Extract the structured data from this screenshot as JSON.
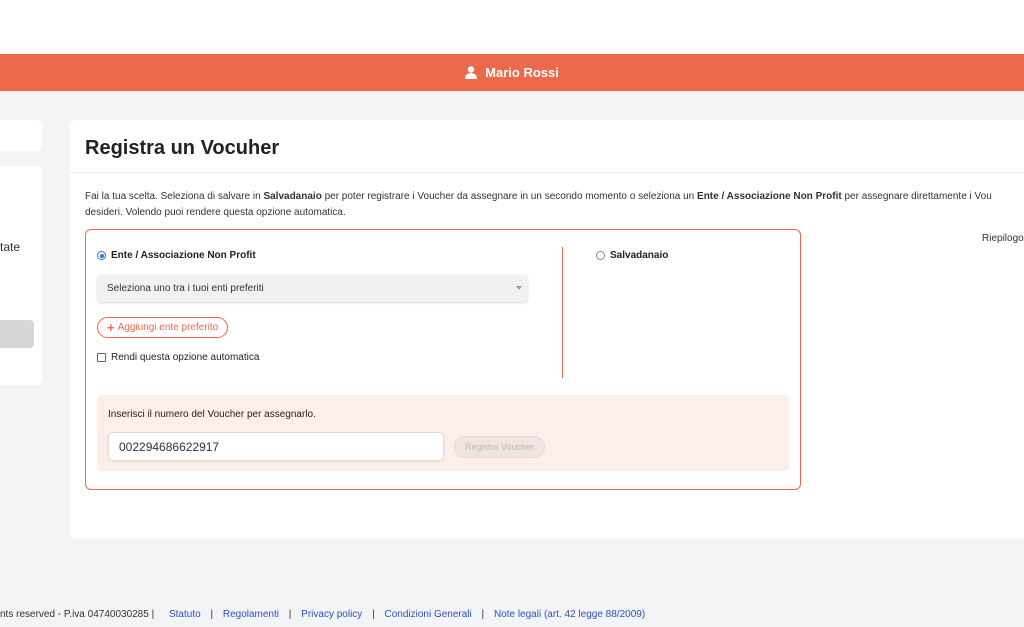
{
  "header": {
    "user_name": "Mario Rossi",
    "user_icon": "user-icon",
    "accent_color": "#ec694b"
  },
  "sidebar": {
    "partial_text": "tate"
  },
  "main": {
    "title": "Registra un Vocuher",
    "intro": {
      "t1": "Fai la tua scelta. Seleziona di salvare in ",
      "b1": "Salvadanaio",
      "t2": " per poter registrare i Voucher da assegnare in un secondo momento o seleziona un ",
      "b2": "Ente / Associazione Non Profit",
      "t3": " per assegnare direttamente i Vou",
      "line2": "desideri. Volendo puoi rendere questa opzione automatica."
    },
    "summary_label": "Riepilogo",
    "option_ente": {
      "label": "Ente / Associazione Non Profit",
      "selected": true
    },
    "option_salvadanaio": {
      "label": "Salvadanaio",
      "selected": false
    },
    "select_value": "Seleziona uno tra i tuoi enti preferiti",
    "add_favorite_label": "Aggiungi ente preferito",
    "automatic_option_label": "Rendi questa opzione automatica",
    "voucher": {
      "label": "Inserisci il numero del Voucher per assegnarlo.",
      "value": "002294686622917",
      "button_label": "Registra Voucher"
    }
  },
  "footer": {
    "text": "nts reserved - P.iva 04740030285 |",
    "links": [
      "Statuto",
      "Regolamenti",
      "Privacy policy",
      "Condizioni Generali",
      "Note legali (art. 42 legge 88/2009)"
    ]
  }
}
